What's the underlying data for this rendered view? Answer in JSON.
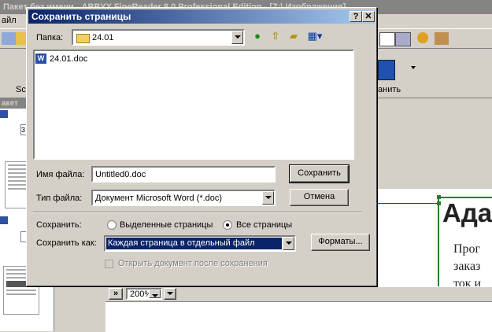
{
  "background": {
    "title": "Пакет без имени - ABBYY FineReader 8.0 Professional Edition - [Z:\\ Изображения]",
    "menu_fragment": "айл",
    "toolbar_left_label": "Sc",
    "toolbar_right_label": "анить",
    "panel_header": "акет",
    "thumb_page_number": "3",
    "zoom_value": "200%",
    "nav_label": "»",
    "doc_heading": "Ада",
    "doc_lines": [
      "Прог",
      "заказ",
      "ток и"
    ]
  },
  "dialog": {
    "title": "Сохранить страницы",
    "help_btn": "?",
    "close_btn": "✕",
    "folder_label": "Папка:",
    "folder_value": "24.01",
    "files": [
      {
        "name": "24.01.doc"
      }
    ],
    "filename_label": "Имя файла:",
    "filename_value": "Untitled0.doc",
    "filetype_label": "Тип файла:",
    "filetype_value": "Документ Microsoft Word (*.doc)",
    "save_btn": "Сохранить",
    "cancel_btn": "Отмена",
    "save_scope_label": "Сохранить:",
    "radio_selected": "Выделенные страницы",
    "radio_all": "Все страницы",
    "save_as_label": "Сохранить как:",
    "save_as_value": "Каждая страница в отдельный файл",
    "formats_btn": "Форматы...",
    "open_after_label": "Открыть документ после сохранения"
  },
  "colors": {
    "title_active": "#0a246a",
    "selection": "#0a246a",
    "frame_green": "#2d7d2d"
  }
}
